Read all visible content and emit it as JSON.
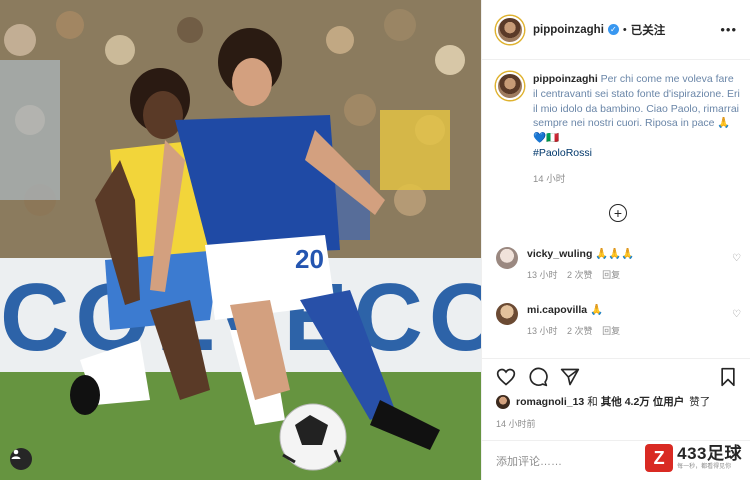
{
  "post": {
    "username": "pippoinzaghi",
    "verified_mark": "✓",
    "separator": "•",
    "follow_status": "已关注",
    "more_icon": "more-horizontal-icon"
  },
  "caption": {
    "username": "pippoinzaghi",
    "text": "Per chi come me voleva fare il centravanti sei stato fonte d'ispirazione. Eri il mio idolo da bambino. Ciao Paolo, rimarrai sempre nei nostri cuori. Riposa in pace 🙏💙🇮🇹",
    "hashtag": "#PaoloRossi",
    "time": "14 小时"
  },
  "load_more": "+",
  "comments": [
    {
      "username": "vicky_wuling",
      "text": "🙏🙏🙏",
      "time": "13 小时",
      "likes": "2 次赞",
      "reply": "回复",
      "avatar_color": "#d9c9c0"
    },
    {
      "username": "mi.capovilla",
      "text": "🙏",
      "time": "13 小时",
      "likes": "2 次赞",
      "reply": "回复",
      "avatar_color": "#c9a57e"
    }
  ],
  "likes": {
    "first_user": "romagnoli_13",
    "connector": "和",
    "others": "其他 4.2万 位用户",
    "suffix": "赞了"
  },
  "post_time": "14 小时前",
  "comment_placeholder": "添加评论……",
  "watermark": {
    "logo": "Z",
    "title": "433足球",
    "subtitle": "每一秒，都看得见你"
  },
  "colors": {
    "verified": "#3897f0",
    "hashtag": "#00376b",
    "muted": "#8e8e8e",
    "watermark": "#d92a23"
  }
}
